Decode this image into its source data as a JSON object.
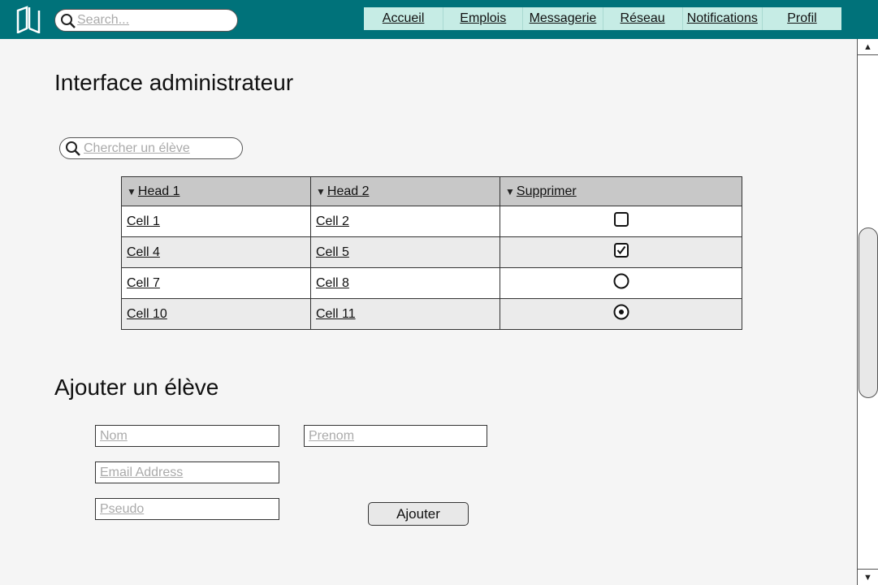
{
  "topbar": {
    "search_placeholder": "Search...",
    "nav": [
      "Accueil",
      "Emplois",
      "Messagerie",
      "Réseau",
      "Notifications",
      "Profil"
    ],
    "color": "#00727a",
    "nav_bg": "#c6ece5"
  },
  "admin": {
    "title": "Interface administrateur",
    "search_placeholder": "Chercher un élève",
    "table": {
      "headers": [
        "Head 1",
        "Head 2",
        "Supprimer"
      ],
      "rows": [
        {
          "c1": "Cell 1",
          "c2": "Cell 2",
          "control": "checkbox",
          "checked": false
        },
        {
          "c1": "Cell 4",
          "c2": "Cell 5",
          "control": "checkbox",
          "checked": true
        },
        {
          "c1": "Cell 7",
          "c2": "Cell 8",
          "control": "radio",
          "checked": false
        },
        {
          "c1": "Cell 10",
          "c2": "Cell 11",
          "control": "radio",
          "checked": true
        }
      ]
    }
  },
  "add_student": {
    "title": "Ajouter un élève",
    "nom_placeholder": "Nom",
    "prenom_placeholder": "Prenom",
    "email_placeholder": "Email Address",
    "pseudo_placeholder": "Pseudo",
    "submit_label": "Ajouter"
  }
}
